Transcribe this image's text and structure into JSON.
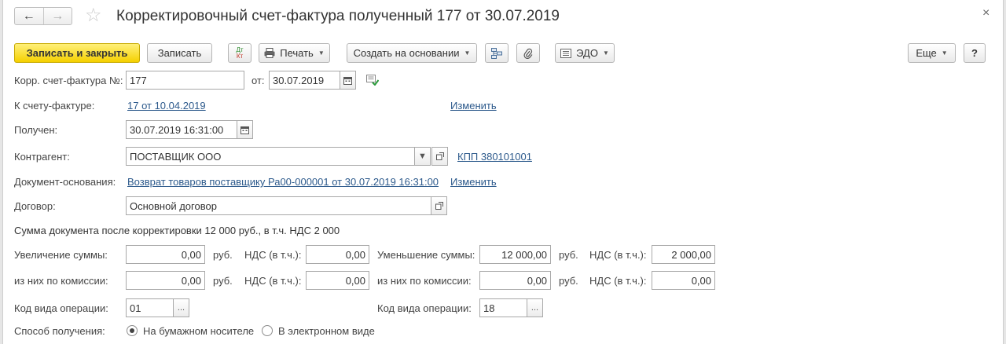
{
  "header": {
    "title": "Корректировочный счет-фактура полученный 177 от 30.07.2019",
    "back_icon": "←",
    "forward_icon": "→",
    "star_icon": "☆",
    "close_icon": "×"
  },
  "toolbar": {
    "save_close": "Записать и закрыть",
    "save": "Записать",
    "dtkt_top": "Дт",
    "dtkt_bottom": "Кт",
    "print": "Печать",
    "create_based": "Создать на основании",
    "edo": "ЭДО",
    "more": "Еще",
    "help": "?"
  },
  "form": {
    "corr_invoice_label": "Корр. счет-фактура №:",
    "corr_invoice_number": "177",
    "date_label": "от:",
    "date_value": "30.07.2019",
    "to_invoice_label": "К счету-фактуре:",
    "to_invoice_link": "17 от 10.04.2019",
    "change_link_1": "Изменить",
    "received_label": "Получен:",
    "received_value": "30.07.2019 16:31:00",
    "counterparty_label": "Контрагент:",
    "counterparty_value": "ПОСТАВЩИК ООО",
    "kpp_link": "КПП 380101001",
    "base_doc_label": "Документ-основания:",
    "base_doc_link": "Возврат товаров поставщику Ра00-000001 от 30.07.2019 16:31:00",
    "change_link_2": "Изменить",
    "contract_label": "Договор:",
    "contract_value": "Основной договор",
    "sum_summary": "Сумма документа после корректировки 12 000 руб., в т.ч. НДС 2 000",
    "increase_label": "Увеличение суммы:",
    "increase_value": "0,00",
    "increase_vat_value": "0,00",
    "decrease_label": "Уменьшение суммы:",
    "decrease_value": "12 000,00",
    "decrease_vat_value": "2 000,00",
    "commission_label": "из них по комиссии:",
    "commission_left_value": "0,00",
    "commission_left_vat_value": "0,00",
    "commission_right_value": "0,00",
    "commission_right_vat_value": "0,00",
    "rub": "руб.",
    "vat_incl_label": "НДС (в т.ч.):",
    "op_code_label": "Код вида операции:",
    "op_code_left": "01",
    "op_code_right": "18",
    "ellipsis": "...",
    "receive_method_label": "Способ получения:",
    "paper_option": "На бумажном носителе",
    "electronic_option": "В электронном виде",
    "selected_receive_method": "На бумажном носителе"
  },
  "colors": {
    "primary_button": "#f5d000",
    "link": "#2d5a8c"
  }
}
